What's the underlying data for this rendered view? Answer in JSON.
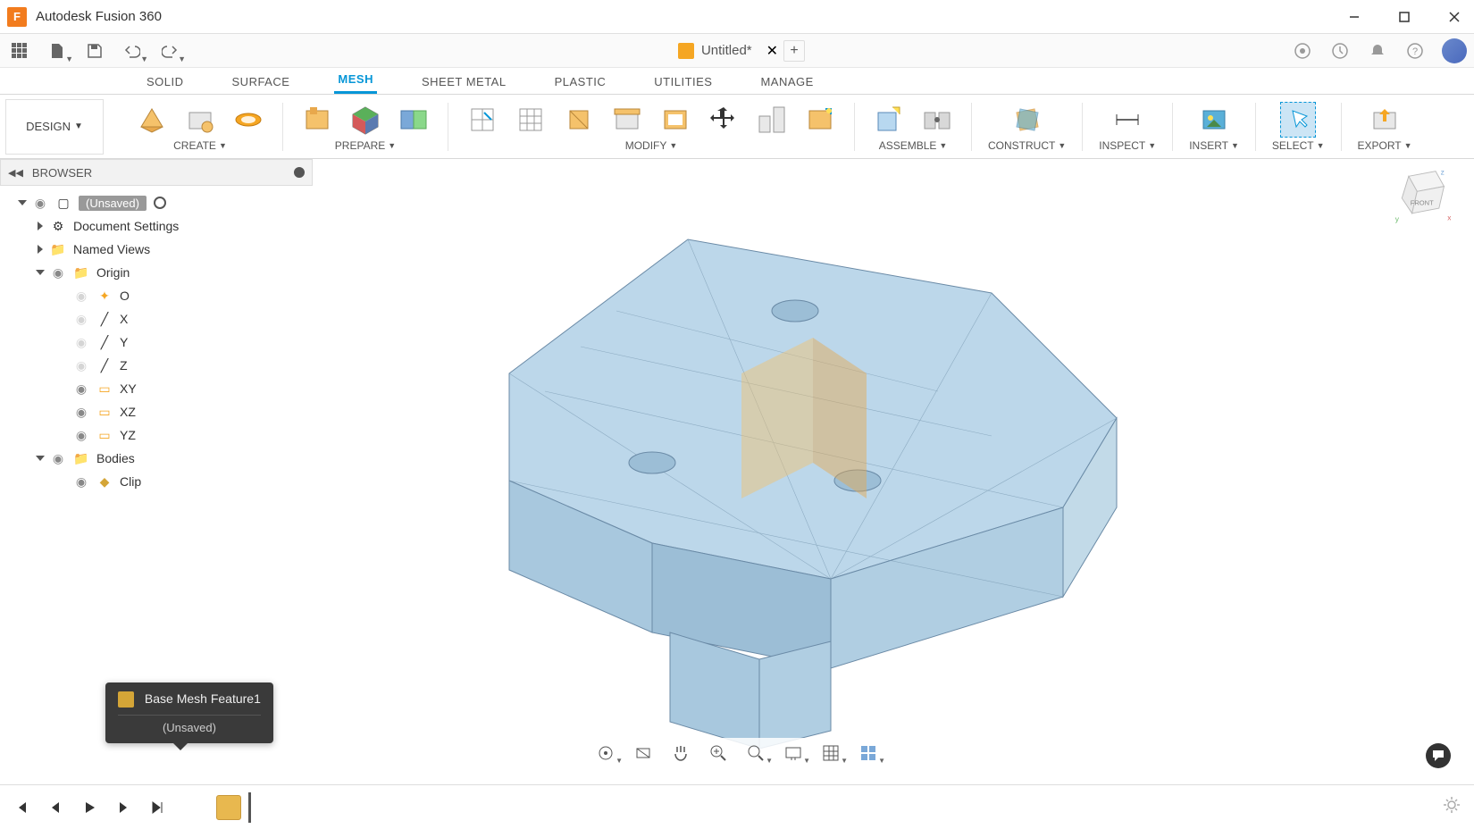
{
  "titlebar": {
    "app_name": "Autodesk Fusion 360"
  },
  "qat": {
    "doc_title": "Untitled*",
    "new_tab": "+"
  },
  "ribbon_tabs": [
    "SOLID",
    "SURFACE",
    "MESH",
    "SHEET METAL",
    "PLASTIC",
    "UTILITIES",
    "MANAGE"
  ],
  "ribbon_active": "MESH",
  "design_label": "DESIGN",
  "ribbon_groups": {
    "create": "CREATE",
    "prepare": "PREPARE",
    "modify": "MODIFY",
    "assemble": "ASSEMBLE",
    "construct": "CONSTRUCT",
    "inspect": "INSPECT",
    "insert": "INSERT",
    "select": "SELECT",
    "export": "EXPORT"
  },
  "browser": {
    "title": "BROWSER",
    "root_badge": "(Unsaved)",
    "items": {
      "doc_settings": "Document Settings",
      "named_views": "Named Views",
      "origin": "Origin",
      "o": "O",
      "x": "X",
      "y": "Y",
      "z": "Z",
      "xy": "XY",
      "xz": "XZ",
      "yz": "YZ",
      "bodies": "Bodies",
      "clip": "Clip"
    }
  },
  "tooltip": {
    "title": "Base Mesh Feature1",
    "sub": "(Unsaved)"
  },
  "viewcube": {
    "front": "FRONT"
  },
  "timeline": {
    "feature": "Base Mesh Feature1"
  }
}
